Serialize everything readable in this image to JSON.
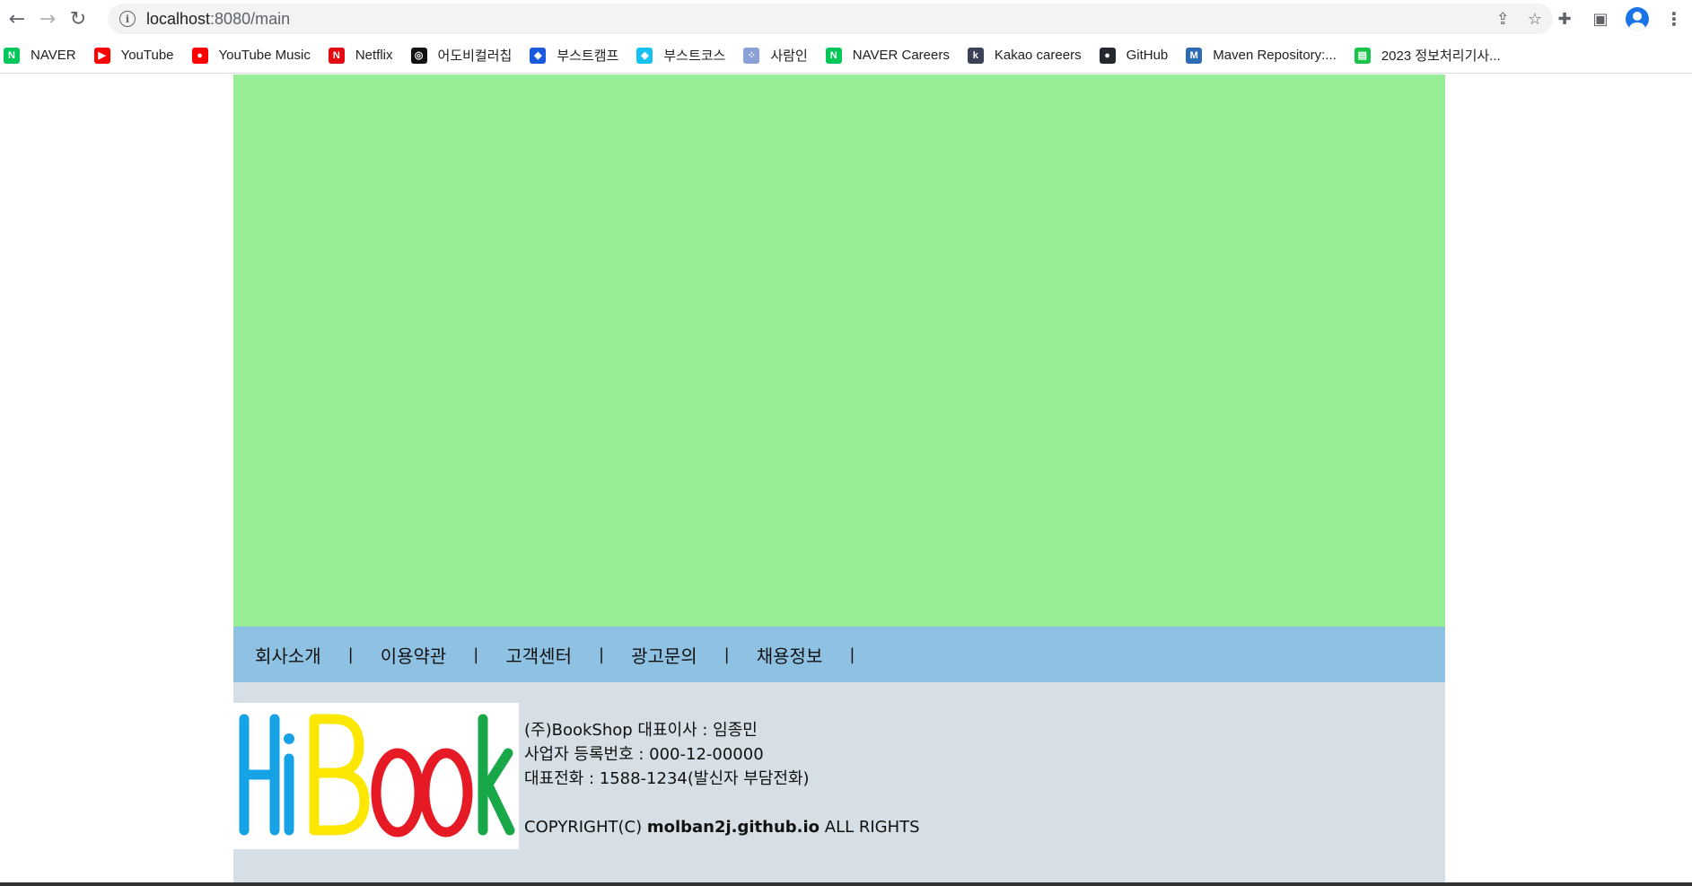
{
  "browser": {
    "url_host": "localhost",
    "url_path": ":8080/main",
    "bookmarks": [
      {
        "label": "NAVER",
        "icon": "naver-icon",
        "color": "#03c75a",
        "glyph": "N"
      },
      {
        "label": "YouTube",
        "icon": "youtube-icon",
        "color": "#ff0000",
        "glyph": "▶"
      },
      {
        "label": "YouTube Music",
        "icon": "youtube-music-icon",
        "color": "#ff0000",
        "glyph": "●"
      },
      {
        "label": "Netflix",
        "icon": "netflix-icon",
        "color": "#e50914",
        "glyph": "N"
      },
      {
        "label": "어도비컬러칩",
        "icon": "adobe-color-icon",
        "color": "#111111",
        "glyph": "◎"
      },
      {
        "label": "부스트캠프",
        "icon": "boostcamp-icon",
        "color": "#1a5adf",
        "glyph": "◆"
      },
      {
        "label": "부스트코스",
        "icon": "boostcourse-icon",
        "color": "#13c2f0",
        "glyph": "◆"
      },
      {
        "label": "사람인",
        "icon": "saramin-icon",
        "color": "#8ca0d8",
        "glyph": "⁘"
      },
      {
        "label": "NAVER Careers",
        "icon": "naver-careers-icon",
        "color": "#03c75a",
        "glyph": "N"
      },
      {
        "label": "Kakao careers",
        "icon": "kakao-icon",
        "color": "#3c4255",
        "glyph": "k"
      },
      {
        "label": "GitHub",
        "icon": "github-icon",
        "color": "#24292f",
        "glyph": "●"
      },
      {
        "label": "Maven Repository:...",
        "icon": "maven-icon",
        "color": "#2d6cb5",
        "glyph": "M"
      },
      {
        "label": "2023 정보처리기사...",
        "icon": "note-icon",
        "color": "#19c34a",
        "glyph": "▤"
      }
    ]
  },
  "footer_nav": [
    {
      "label": "회사소개",
      "sep": "|"
    },
    {
      "label": "이용약관",
      "sep": "|"
    },
    {
      "label": "고객센터",
      "sep": "|"
    },
    {
      "label": "광고문의",
      "sep": "|"
    },
    {
      "label": "채용정보",
      "sep": "|"
    }
  ],
  "logo": {
    "text": "HiBook",
    "letters": [
      {
        "ch": "H",
        "color": "#16a3e6"
      },
      {
        "ch": "i",
        "color": "#16a3e6"
      },
      {
        "ch": "B",
        "color": "#fbe700"
      },
      {
        "ch": "o",
        "color": "#e51a24"
      },
      {
        "ch": "o",
        "color": "#e51a24"
      },
      {
        "ch": "k",
        "color": "#18a84a"
      }
    ]
  },
  "company": {
    "line1": "(주)BookShop 대표이사 : 임종민",
    "line2": "사업자 등록번호 : 000-12-00000",
    "line3": "대표전화 : 1588-1234(발신자 부담전화)",
    "copyright_prefix": "COPYRIGHT(C) ",
    "copyright_site": "molban2j.github.io",
    "copyright_suffix": " ALL RIGHTS"
  },
  "colors": {
    "hero": "#98ee96",
    "footer_nav": "#8fc1e3",
    "footer_info": "#d5dfe5"
  }
}
